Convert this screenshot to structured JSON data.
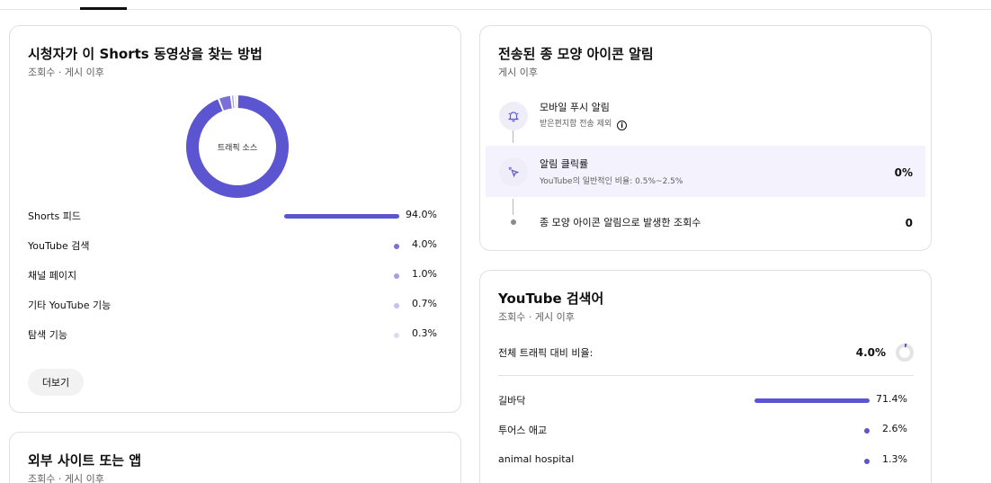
{
  "traffic_card": {
    "title": "시청자가 이 Shorts 동영상을 찾는 방법",
    "subtitle": "조회수 · 게시 이후",
    "donut_center": "트래픽 소스",
    "sources": [
      {
        "label": "Shorts 피드",
        "pct": "94.0%",
        "value": 94.0,
        "color": "#5c55d1"
      },
      {
        "label": "YouTube 검색",
        "pct": "4.0%",
        "value": 4.0,
        "color": "#7a70d6"
      },
      {
        "label": "채널 페이지",
        "pct": "1.0%",
        "value": 1.0,
        "color": "#a49fe0"
      },
      {
        "label": "기타 YouTube 기능",
        "pct": "0.7%",
        "value": 0.7,
        "color": "#c5c1ec"
      },
      {
        "label": "탐색 기능",
        "pct": "0.3%",
        "value": 0.3,
        "color": "#dddbf2"
      }
    ],
    "more_label": "더보기"
  },
  "external_card": {
    "title": "외부 사이트 또는 앱",
    "subtitle": "조회수 · 게시 이후"
  },
  "bell_card": {
    "title": "전송된 종 모양 아이콘 알림",
    "subtitle": "게시 이후",
    "steps": [
      {
        "title": "모바일 푸시 알림",
        "sub": "받은편지함 전송 제외",
        "info_icon": "info-icon",
        "value": ""
      },
      {
        "title": "알림 클릭률",
        "sub": "YouTube의 일반적인 비율: 0.5%~2.5%",
        "value": "0%"
      },
      {
        "title": "종 모양 아이콘 알림으로 발생한 조회수",
        "sub": "",
        "value": "0"
      }
    ]
  },
  "search_card": {
    "title": "YouTube 검색어",
    "subtitle": "조회수 · 게시 이후",
    "total_label": "전체 트래픽 대비 비율:",
    "total_pct": "4.0%",
    "total_value": 4.0,
    "terms": [
      {
        "label": "길바닥",
        "pct": "71.4%",
        "value": 71.4
      },
      {
        "label": "투어스 애교",
        "pct": "2.6%",
        "value": 2.6
      },
      {
        "label": "animal hospital",
        "pct": "1.3%",
        "value": 1.3
      }
    ],
    "accent": "#5c55d1"
  }
}
